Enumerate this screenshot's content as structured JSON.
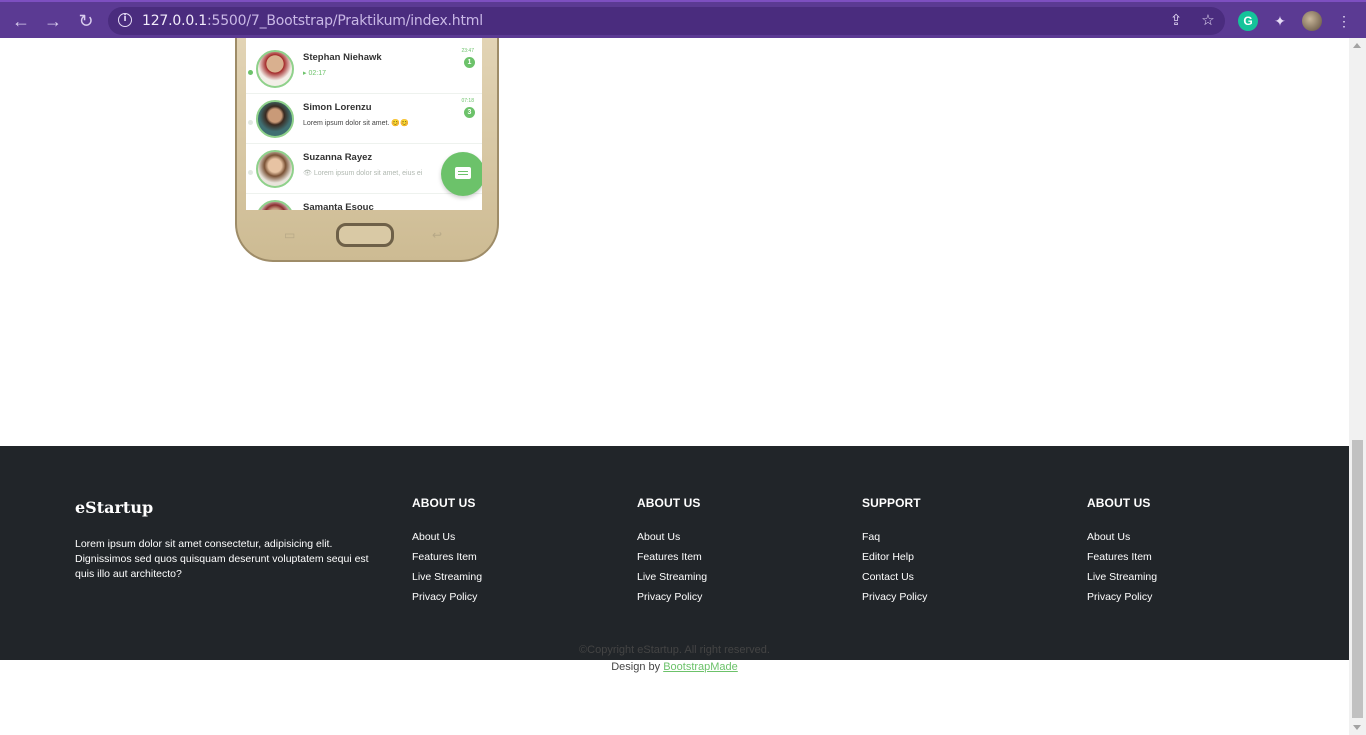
{
  "browser": {
    "url_host": "127.0.0.1",
    "url_rest": ":5500/7_Bootstrap/Praktikum/index.html",
    "grammarly_letter": "G"
  },
  "phone": {
    "chats": [
      {
        "name": "Stephan Niehawk",
        "message": "▸ 02:17",
        "time": "23:47",
        "badge": "1",
        "style": "green"
      },
      {
        "name": "Simon Lorenzu",
        "message": "Lorem ipsum dolor sit amet. 😊😊",
        "time": "07:18",
        "badge": "3",
        "style": "normal"
      },
      {
        "name": "Suzanna Rayez",
        "message": "👁 Lorem ipsum dolor sit amet, eius ei",
        "time": "",
        "badge": "",
        "style": "faint"
      },
      {
        "name": "Samanta Esouc",
        "message": "",
        "time": "",
        "badge": "",
        "style": "normal"
      }
    ]
  },
  "footer": {
    "brand": "eStartup",
    "about": "Lorem ipsum dolor sit amet consectetur, adipisicing elit. Dignissimos sed quos quisquam deserunt voluptatem sequi est quis illo aut architecto?",
    "columns": [
      {
        "title": "ABOUT US",
        "links": [
          "About Us",
          "Features Item",
          "Live Streaming",
          "Privacy Policy"
        ]
      },
      {
        "title": "ABOUT US",
        "links": [
          "About Us",
          "Features Item",
          "Live Streaming",
          "Privacy Policy"
        ]
      },
      {
        "title": "SUPPORT",
        "links": [
          "Faq",
          "Editor Help",
          "Contact Us",
          "Privacy Policy"
        ]
      },
      {
        "title": "ABOUT US",
        "links": [
          "About Us",
          "Features Item",
          "Live Streaming",
          "Privacy Policy"
        ]
      }
    ]
  },
  "copyright": {
    "line1": "©Copyright eStartup. All right reserved.",
    "design_prefix": "Design by ",
    "design_link": "BootstrapMade"
  },
  "colors": {
    "accent_green": "#6cc26a",
    "footer_bg": "#212529",
    "chrome_bg": "#5b3a93"
  }
}
